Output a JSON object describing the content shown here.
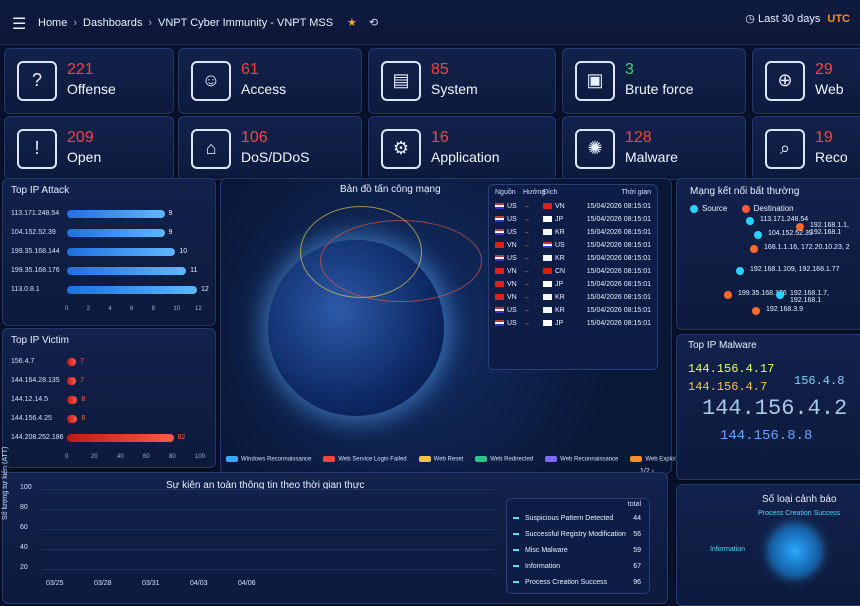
{
  "header": {
    "menu_icon": "menu-icon",
    "breadcrumb": [
      "Home",
      "Dashboards",
      "VNPT Cyber Immunity - VNPT MSS"
    ],
    "range_label": "Last 30 days",
    "timezone": "UTC"
  },
  "stats": [
    {
      "value": "221",
      "label": "Offense",
      "icon": "shield-question-icon"
    },
    {
      "value": "61",
      "label": "Access",
      "icon": "user-icon"
    },
    {
      "value": "85",
      "label": "System",
      "icon": "server-icon"
    },
    {
      "value": "3",
      "label": "Brute force",
      "icon": "monitor-user-icon"
    },
    {
      "value": "29",
      "label": "Web",
      "icon": "globe-www-icon"
    },
    {
      "value": "209",
      "label": "Open",
      "icon": "shield-alert-icon"
    },
    {
      "value": "106",
      "label": "DoS/DDoS",
      "icon": "network-icon"
    },
    {
      "value": "16",
      "label": "Application",
      "icon": "gear-icon"
    },
    {
      "value": "128",
      "label": "Malware",
      "icon": "virus-icon"
    },
    {
      "value": "19",
      "label": "Reco",
      "icon": "magnifier-icon"
    }
  ],
  "top_ip_attack": {
    "title": "Top IP Attack",
    "rows": [
      {
        "ip": "113.171.248.54",
        "value": 9
      },
      {
        "ip": "104.152.52.39",
        "value": 9
      },
      {
        "ip": "199.35.168.144",
        "value": 10
      },
      {
        "ip": "199.35.168.176",
        "value": 11
      },
      {
        "ip": "113.0.8.1",
        "value": 12
      }
    ],
    "ticks": [
      "0",
      "2",
      "4",
      "6",
      "8",
      "10",
      "12"
    ],
    "max": 12
  },
  "top_ip_victim": {
    "title": "Top IP Victim",
    "rows": [
      {
        "ip": "156.4.7",
        "value": 7
      },
      {
        "ip": "144.164.28.135",
        "value": 7
      },
      {
        "ip": "144.12.14.5",
        "value": 8
      },
      {
        "ip": "144.156.4.25",
        "value": 8
      },
      {
        "ip": "144.208.252.186",
        "value": 82
      }
    ],
    "ticks": [
      "0",
      "20",
      "40",
      "60",
      "80",
      "100"
    ],
    "max": 100
  },
  "attack_map": {
    "title": "Bản đồ tấn công mạng",
    "headers": [
      "Nguồn",
      "Hướng",
      "Đích",
      "Thời gian"
    ],
    "rows": [
      {
        "src": "US",
        "dst": "VN",
        "time": "15/04/2026 08:15:01"
      },
      {
        "src": "US",
        "dst": "JP",
        "time": "15/04/2026 08:15:01"
      },
      {
        "src": "US",
        "dst": "KR",
        "time": "15/04/2026 08:15:01"
      },
      {
        "src": "VN",
        "dst": "US",
        "time": "15/04/2026 08:15:01"
      },
      {
        "src": "US",
        "dst": "KR",
        "time": "15/04/2026 08:15:01"
      },
      {
        "src": "VN",
        "dst": "CN",
        "time": "15/04/2026 08:15:01"
      },
      {
        "src": "VN",
        "dst": "JP",
        "time": "15/04/2026 08:15:01"
      },
      {
        "src": "VN",
        "dst": "KR",
        "time": "15/04/2026 08:15:01"
      },
      {
        "src": "US",
        "dst": "KR",
        "time": "15/04/2026 08:15:01"
      },
      {
        "src": "US",
        "dst": "JP",
        "time": "15/04/2026 08:15:01"
      }
    ],
    "legend": [
      {
        "label": "Windows Reconnaissance",
        "color": "#3aa8ff"
      },
      {
        "label": "Web Service Login Failed",
        "color": "#ff4040"
      },
      {
        "label": "Web Reset",
        "color": "#f5c542"
      },
      {
        "label": "Web Redirected",
        "color": "#28c78a"
      },
      {
        "label": "Web Reconnaissance",
        "color": "#7b6cff"
      },
      {
        "label": "Web Exploit",
        "color": "#ff8a2a"
      }
    ],
    "page": "1/2"
  },
  "network": {
    "title": "Mạng kết nối bất thường",
    "legend_source": "Source",
    "legend_destination": "Destination",
    "ips": [
      "113.171.248.54",
      "192.168.1.1, 192.168.1",
      "104.152.52.39",
      "168.1.1.16, 172.20.10.23, 2",
      "192.168.1.109, 192.168.1.77",
      "199.35.168.176",
      "192.168.1.7, 192.168.1",
      "192.168.3.9"
    ]
  },
  "top_ip_malware": {
    "title": "Top IP Malware",
    "ips": [
      "144.156.4.17",
      "144.156.4.7",
      "156.4.8",
      "144.156.4.2",
      "144.156.8.8"
    ]
  },
  "events": {
    "title": "Sự kiện an toàn thông tin theo thời gian thực",
    "ylabel": "Số lượng sự kiện (ATT)",
    "yticks": [
      "100",
      "80",
      "60",
      "40",
      "20"
    ],
    "xticks": [
      "03/25",
      "03/28",
      "03/31",
      "04/03",
      "04/06"
    ],
    "total_label": "total",
    "items": [
      {
        "label": "Suspicious Pattern Detected",
        "value": "44"
      },
      {
        "label": "Successful Registry Modification",
        "value": "56"
      },
      {
        "label": "Misc Malware",
        "value": "59"
      },
      {
        "label": "Information",
        "value": "67"
      },
      {
        "label": "Process Creation Success",
        "value": "96"
      }
    ]
  },
  "alert_types": {
    "title": "Số loại cảnh báo",
    "label_top": "Process Creation Success",
    "label_left": "Information"
  }
}
